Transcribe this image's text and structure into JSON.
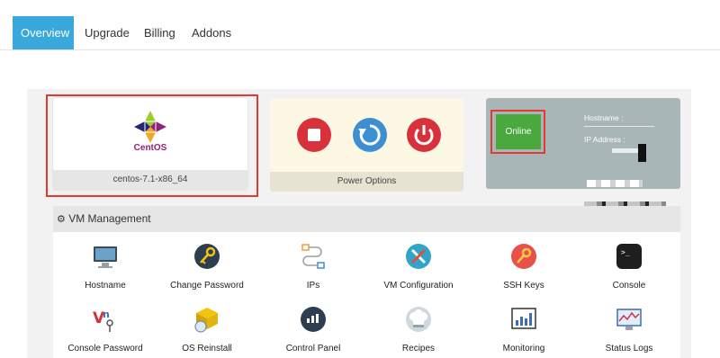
{
  "tabs": [
    "Overview",
    "Upgrade",
    "Billing",
    "Addons"
  ],
  "os": {
    "logo_text": "CentOS",
    "name": "centos-7.1-x86_64"
  },
  "power": {
    "label": "Power Options",
    "buttons": [
      {
        "name": "stop",
        "color": "#d9313b"
      },
      {
        "name": "restart",
        "color": "#3c8fd0"
      },
      {
        "name": "power",
        "color": "#d9313b"
      }
    ]
  },
  "status": {
    "state": "Online",
    "hostname_label": "Hostname :",
    "ip_label": "IP Address :"
  },
  "vm": {
    "title": "VM Management",
    "items": [
      {
        "label": "Hostname",
        "icon": "monitor-icon"
      },
      {
        "label": "Change Password",
        "icon": "key-icon"
      },
      {
        "label": "IPs",
        "icon": "network-icon"
      },
      {
        "label": "VM Configuration",
        "icon": "tools-icon"
      },
      {
        "label": "SSH Keys",
        "icon": "ssh-key-icon"
      },
      {
        "label": "Console",
        "icon": "terminal-icon"
      },
      {
        "label": "Console Password",
        "icon": "vnc-icon"
      },
      {
        "label": "OS Reinstall",
        "icon": "reinstall-icon"
      },
      {
        "label": "Control Panel",
        "icon": "control-panel-icon"
      },
      {
        "label": "Recipes",
        "icon": "chef-hat-icon"
      },
      {
        "label": "Monitoring",
        "icon": "chart-icon"
      },
      {
        "label": "Status Logs",
        "icon": "status-logs-icon"
      }
    ]
  },
  "colors": {
    "accent": "#39a9db",
    "online": "#4aa83f",
    "highlight": "#e03a32"
  }
}
